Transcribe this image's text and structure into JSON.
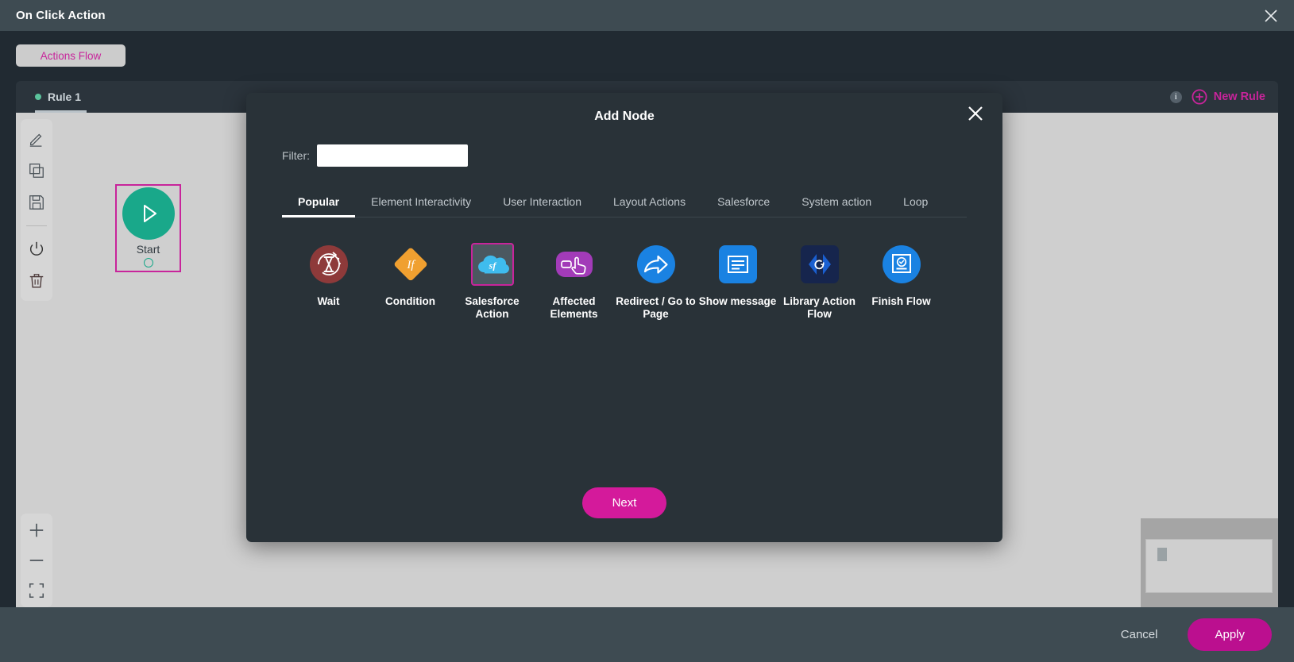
{
  "window": {
    "title": "On Click Action",
    "close_icon": "close-icon"
  },
  "toolbar": {
    "flow_chip_label": "Actions Flow"
  },
  "rule_bar": {
    "rule_label": "Rule 1",
    "info_label": "i",
    "new_rule_label": "New Rule"
  },
  "canvas": {
    "tools": [
      {
        "name": "edit-tool",
        "icon": "pencil-icon"
      },
      {
        "name": "duplicate-tool",
        "icon": "copy-icon"
      },
      {
        "name": "save-tool",
        "icon": "save-icon"
      },
      {
        "name": "disable-tool",
        "icon": "power-icon"
      },
      {
        "name": "delete-tool",
        "icon": "trash-icon"
      }
    ],
    "zoom_tools": [
      {
        "name": "zoom-in-button",
        "icon": "plus-icon"
      },
      {
        "name": "zoom-out-button",
        "icon": "minus-icon"
      },
      {
        "name": "fit-to-screen-button",
        "icon": "expand-icon"
      }
    ],
    "start_node": {
      "label": "Start",
      "icon": "play-icon"
    }
  },
  "modal": {
    "title": "Add Node",
    "close_icon": "close-icon",
    "filter": {
      "label": "Filter:",
      "value": "",
      "placeholder": ""
    },
    "tabs": [
      {
        "label": "Popular",
        "active": true
      },
      {
        "label": "Element Interactivity",
        "active": false
      },
      {
        "label": "User Interaction",
        "active": false
      },
      {
        "label": "Layout Actions",
        "active": false
      },
      {
        "label": "Salesforce",
        "active": false
      },
      {
        "label": "System action",
        "active": false
      },
      {
        "label": "Loop",
        "active": false
      }
    ],
    "nodes": [
      {
        "label": "Wait",
        "icon": "hourglass-icon",
        "selected": false,
        "color": "#8e3a3a"
      },
      {
        "label": "Condition",
        "icon": "diamond-if-icon",
        "selected": false,
        "color": "#f0a030"
      },
      {
        "label": "Salesforce Action",
        "icon": "salesforce-cloud-icon",
        "selected": true,
        "color": "#3fbcee"
      },
      {
        "label": "Affected Elements",
        "icon": "click-hand-icon",
        "selected": false,
        "color": "#a23bb8"
      },
      {
        "label": "Redirect / Go to Page",
        "icon": "share-arrow-icon",
        "selected": false,
        "color": "#1a82e2"
      },
      {
        "label": "Show message",
        "icon": "message-box-icon",
        "selected": false,
        "color": "#1a82e2"
      },
      {
        "label": "Library Action Flow",
        "icon": "code-brackets-icon",
        "selected": false,
        "color": "#16254d"
      },
      {
        "label": "Finish Flow",
        "icon": "finish-check-icon",
        "selected": false,
        "color": "#1a82e2"
      }
    ],
    "next_label": "Next"
  },
  "footer": {
    "cancel_label": "Cancel",
    "apply_label": "Apply"
  },
  "colors": {
    "accent_pink": "#c8249b",
    "apply_pink": "#bb0f8f",
    "start_green": "#19a88a",
    "panel_dark": "#293238",
    "canvas_grey": "#cfcfcf"
  }
}
